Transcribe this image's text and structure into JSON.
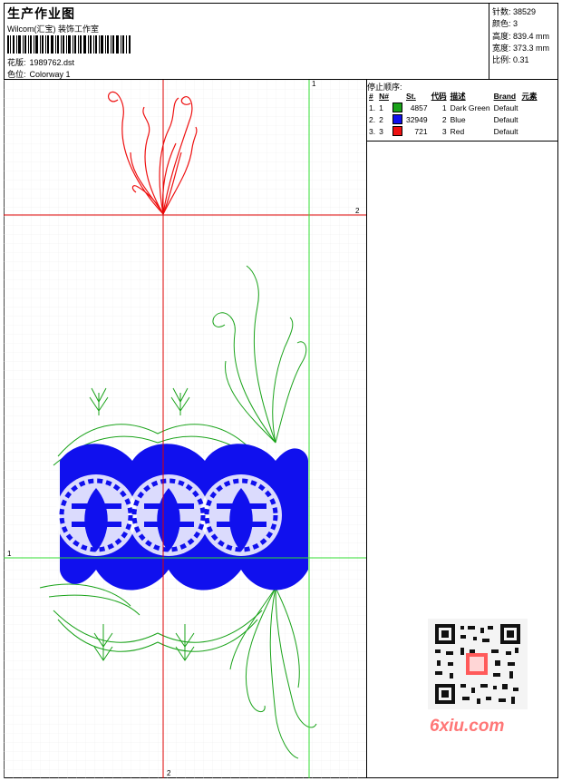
{
  "header": {
    "title": "生产作业图",
    "software": "Wilcom(汇宝) 装饰工作室",
    "design_label": "花版:",
    "design_value": "1989762.dst",
    "colorway_label": "色位:",
    "colorway_value": "Colorway 1"
  },
  "stats": {
    "stitches_label": "针数:",
    "stitches_value": "38529",
    "colors_label": "颜色:",
    "colors_value": "3",
    "height_label": "高度:",
    "height_value": "839.4 mm",
    "width_label": "宽度:",
    "width_value": "373.3 mm",
    "scale_label": "比例:",
    "scale_value": "0.31"
  },
  "stop_sequence": {
    "title": "停止顺序:",
    "headers": [
      "#",
      "N#",
      "St.",
      "代码",
      "描述",
      "Brand",
      "元素"
    ],
    "rows": [
      {
        "idx": "1.",
        "n": "1",
        "color": "#1aa31a",
        "stitches": "4857",
        "code": "1",
        "desc": "Dark Green",
        "brand": "Default"
      },
      {
        "idx": "2.",
        "n": "2",
        "color": "#1010ee",
        "stitches": "32949",
        "code": "2",
        "desc": "Blue",
        "brand": "Default"
      },
      {
        "idx": "3.",
        "n": "3",
        "color": "#ee1111",
        "stitches": "721",
        "code": "3",
        "desc": "Red",
        "brand": "Default"
      }
    ]
  },
  "canvas_marks": {
    "top_right": "1",
    "red_line_right": "2",
    "left_middle": "1",
    "bottom": "2"
  },
  "watermark": "6xiu.com",
  "colors": {
    "green": "#1aa31a",
    "blue": "#1010ee",
    "red": "#ee1111",
    "guide_green": "#33dd33",
    "guide_red": "#dd0000",
    "watermark": "#ff7777"
  }
}
